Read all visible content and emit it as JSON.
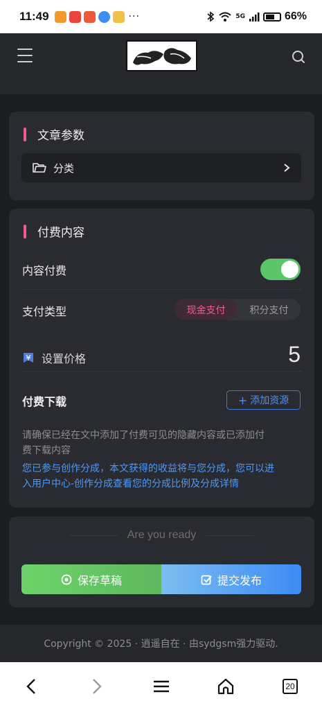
{
  "status_bar": {
    "time": "11:49",
    "more": "···",
    "network": "5G",
    "battery": "66%"
  },
  "header": {
    "logo_alt": "site-logo"
  },
  "article_params": {
    "title": "文章参数",
    "category_label": "分类"
  },
  "paid": {
    "title": "付费内容",
    "content_paid_label": "内容付费",
    "content_paid_on": true,
    "pay_type_label": "支付类型",
    "pay_types": [
      "现金支付",
      "积分支付"
    ],
    "pay_type_selected": "现金支付",
    "price_label": "设置价格",
    "price_value": "5",
    "download_label": "付费下载",
    "add_resource_label": "添加资源",
    "note_gray_line1": "请确保已经在文中添加了付费可见的隐藏内容或已添加付",
    "note_gray_line2": "费下载内容",
    "note_blue_line1": "您已参与创作分成，本文获得的收益将与您分成，您可以进",
    "note_blue_line2": "入用户中心-创作分成查看您的分成比例及分成详情"
  },
  "actions": {
    "ready_text": "Are you ready",
    "save_label": "保存草稿",
    "submit_label": "提交发布"
  },
  "footer": {
    "copyright": "Copyright © 2025 · 逍遥自在 · 由sydgsm强力驱动."
  },
  "browser_nav": {
    "tab_count": "20"
  },
  "colors": {
    "accent_pink": "#f05a9a",
    "toggle_green": "#5bc56a",
    "link_blue": "#4f98f5",
    "card_bg": "#2a2b30"
  }
}
